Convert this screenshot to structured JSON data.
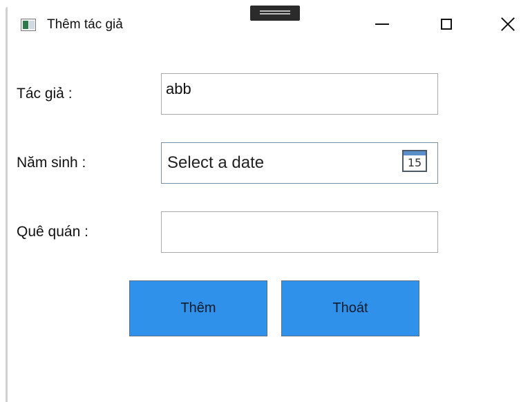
{
  "window": {
    "title": "Thêm tác giả"
  },
  "form": {
    "author_label": "Tác giả :",
    "author_value": "abb",
    "birth_year_label": "Năm sinh :",
    "birth_year_placeholder": "Select a date",
    "calendar_day": "15",
    "hometown_label": "Quê quán :",
    "hometown_value": ""
  },
  "buttons": {
    "add_label": "Thêm",
    "exit_label": "Thoát"
  },
  "colors": {
    "button_bg": "#2f91ea",
    "field_border": "#a9a9a9"
  }
}
